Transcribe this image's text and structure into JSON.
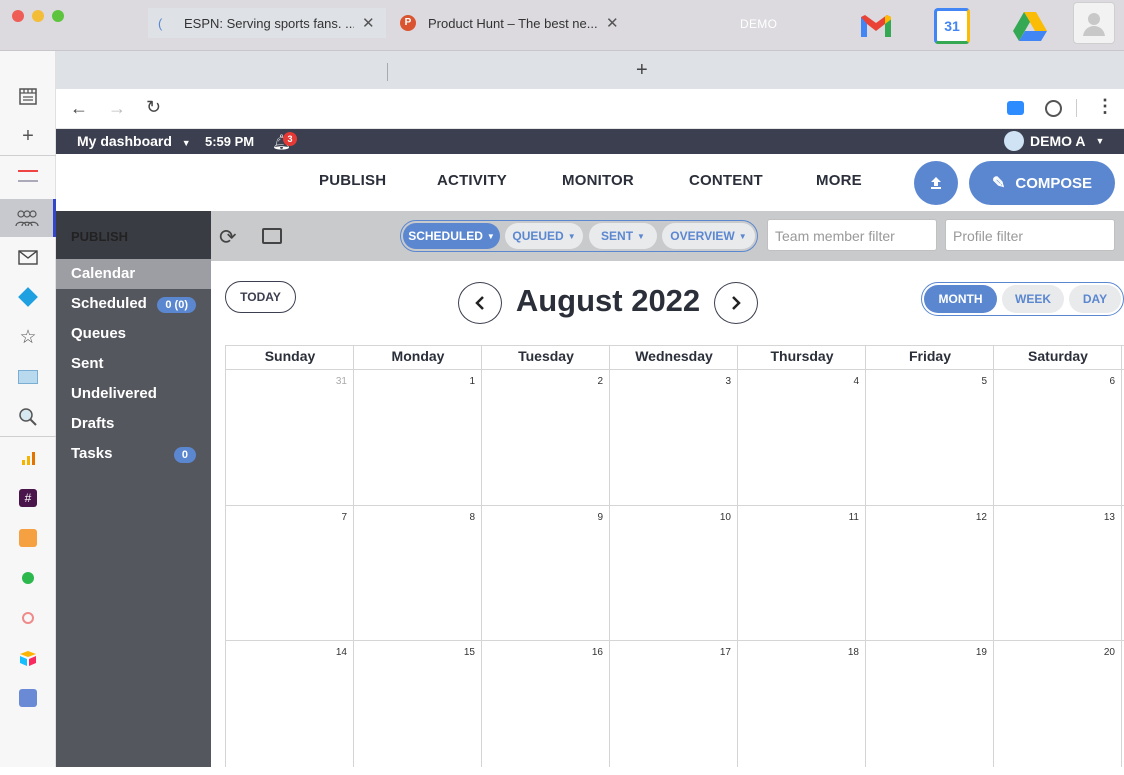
{
  "os": {
    "demo_label": "DEMO"
  },
  "apps": {
    "calendar_day": "31"
  },
  "browser": {
    "tabs": [
      {
        "title": "ESPN: Serving sports fans. ..."
      },
      {
        "title": "Product Hunt – The best ne..."
      }
    ]
  },
  "app": {
    "dashboard_label": "My dashboard",
    "time": "5:59 PM",
    "notifications": "3",
    "user": "DEMO A"
  },
  "nav": {
    "items": [
      "PUBLISH",
      "ACTIVITY",
      "MONITOR",
      "CONTENT",
      "MORE"
    ],
    "compose": "COMPOSE"
  },
  "sidebar": {
    "title": "PUBLISH",
    "items": [
      {
        "label": "Calendar"
      },
      {
        "label": "Scheduled",
        "badge": "0 (0)"
      },
      {
        "label": "Queues"
      },
      {
        "label": "Sent"
      },
      {
        "label": "Undelivered"
      },
      {
        "label": "Drafts"
      },
      {
        "label": "Tasks",
        "badge": "0"
      }
    ]
  },
  "filters": {
    "pills": [
      "SCHEDULED",
      "QUEUED",
      "SENT",
      "OVERVIEW"
    ],
    "team_placeholder": "Team member filter",
    "profile_placeholder": "Profile filter"
  },
  "calendar": {
    "today": "TODAY",
    "title": "August 2022",
    "views": [
      "MONTH",
      "WEEK",
      "DAY"
    ],
    "days": [
      "Sunday",
      "Monday",
      "Tuesday",
      "Wednesday",
      "Thursday",
      "Friday",
      "Saturday"
    ],
    "weeks": [
      [
        "31",
        "1",
        "2",
        "3",
        "4",
        "5",
        "6"
      ],
      [
        "7",
        "8",
        "9",
        "10",
        "11",
        "12",
        "13"
      ],
      [
        "14",
        "15",
        "16",
        "17",
        "18",
        "19",
        "20"
      ]
    ]
  },
  "colors": {
    "accent": "#5b87d0",
    "header": "#3c3f4f",
    "sidebar": "#55575e"
  }
}
